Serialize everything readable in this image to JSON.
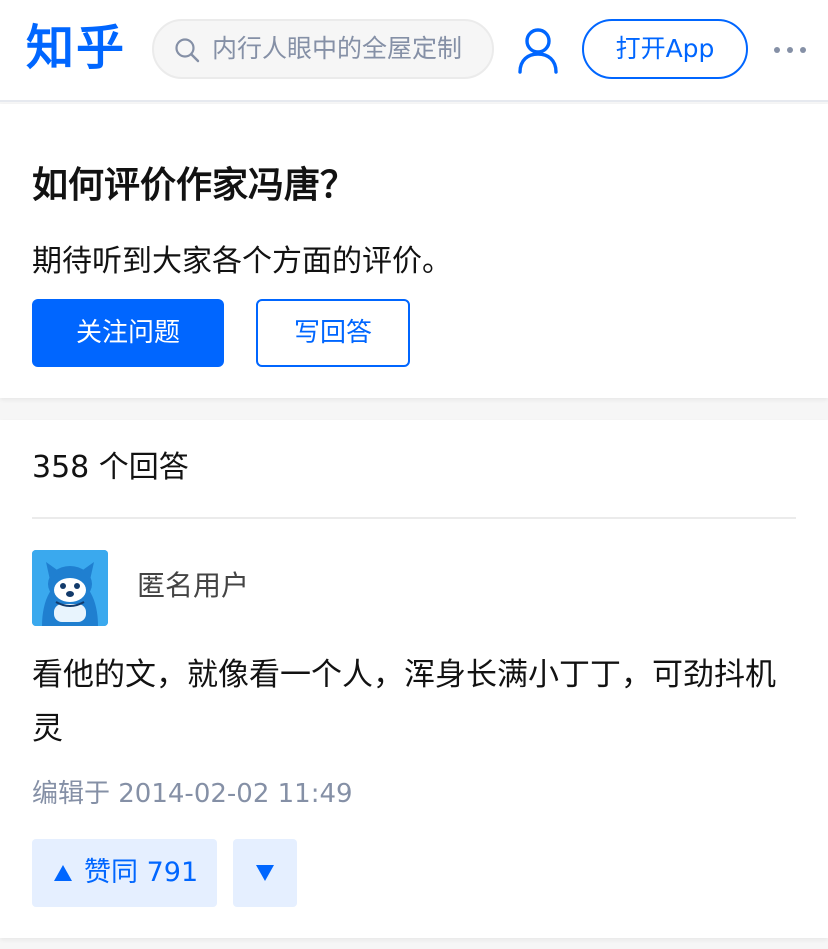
{
  "header": {
    "logo": "知乎",
    "search_placeholder": "内行人眼中的全屋定制",
    "open_app_label": "打开App",
    "icons": [
      "search-icon",
      "profile-icon",
      "more-icon"
    ]
  },
  "question": {
    "title": "如何评价作家冯唐？",
    "description": "期待听到大家各个方面的评价。",
    "follow_label": "关注问题",
    "write_answer_label": "写回答"
  },
  "answers": {
    "count_label": "358 个回答",
    "items": [
      {
        "author": "匿名用户",
        "content": "看他的文，就像看一个人，浑身长满小丁丁，可劲抖机灵",
        "edited": "编辑于 2014-02-02 11:49",
        "upvote_label": "赞同 791"
      }
    ]
  },
  "colors": {
    "brand": "#0066ff",
    "vote_bg": "#e5efff",
    "meta_text": "#8590a6"
  }
}
